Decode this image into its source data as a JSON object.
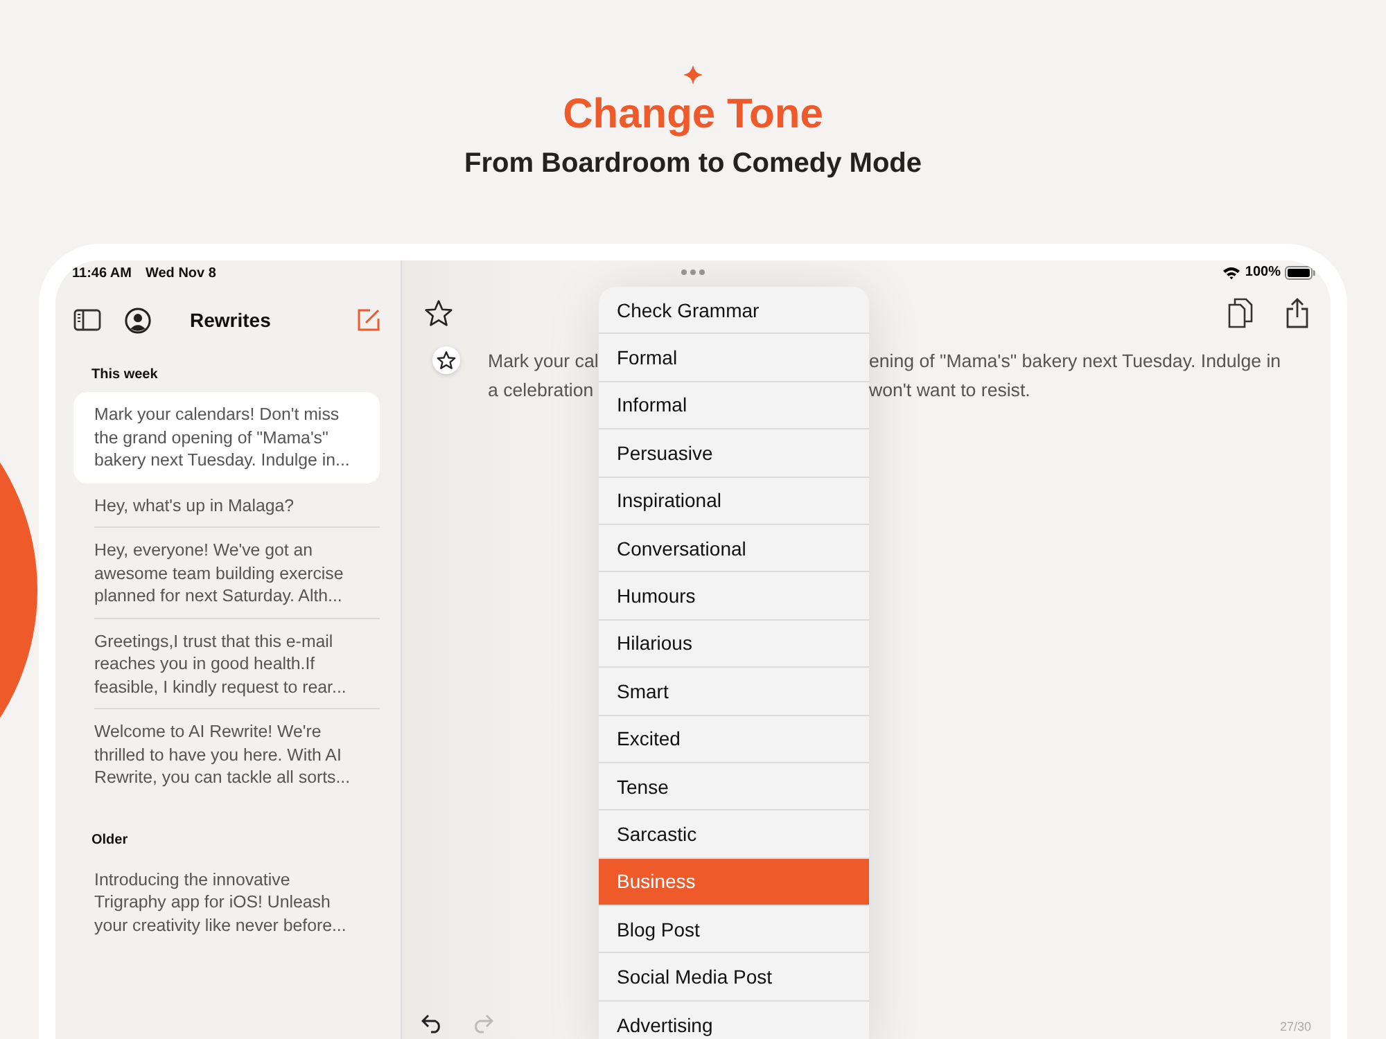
{
  "header": {
    "title": "Change Tone",
    "subtitle": "From Boardroom to Comedy Mode"
  },
  "status_bar": {
    "time": "11:46 AM",
    "date": "Wed Nov 8",
    "battery": "100%"
  },
  "sidebar": {
    "title": "Rewrites",
    "sections": [
      {
        "title": "This week",
        "items": [
          {
            "text": "Mark your calendars! Don't miss the grand opening of \"Mama's\" bakery next Tuesday. Indulge in...",
            "selected": true
          },
          {
            "text": "Hey, what's up in Malaga?",
            "selected": false
          },
          {
            "text": "Hey, everyone! We've got an awesome team building exercise planned for next Saturday. Alth...",
            "selected": false
          },
          {
            "text": "Greetings,I trust that this e-mail reaches you in good health.If feasible, I kindly request to rear...",
            "selected": false
          },
          {
            "text": "Welcome to AI Rewrite! We're thrilled to have you here. With AI Rewrite, you can tackle all sorts...",
            "selected": false
          }
        ]
      },
      {
        "title": "Older",
        "items": [
          {
            "text": "Introducing the innovative Trigraphy app for iOS! Unleash your creativity like never before...",
            "selected": false
          }
        ]
      }
    ]
  },
  "editor": {
    "lines": [
      {
        "left": "Mark your cal",
        "right": "ening of \"Mama's\" bakery next Tuesday. Indulge in"
      },
      {
        "left": "a celebration",
        "right": "won't want to resist."
      }
    ],
    "undo": {
      "disabled": false
    },
    "redo": {
      "disabled": true
    },
    "counter": "27/30"
  },
  "menu": {
    "items": [
      {
        "label": "Check Grammar",
        "selected": false
      },
      {
        "label": "Formal",
        "selected": false
      },
      {
        "label": "Informal",
        "selected": false
      },
      {
        "label": "Persuasive",
        "selected": false
      },
      {
        "label": "Inspirational",
        "selected": false
      },
      {
        "label": "Conversational",
        "selected": false
      },
      {
        "label": "Humours",
        "selected": false
      },
      {
        "label": "Hilarious",
        "selected": false
      },
      {
        "label": "Smart",
        "selected": false
      },
      {
        "label": "Excited",
        "selected": false
      },
      {
        "label": "Tense",
        "selected": false
      },
      {
        "label": "Sarcastic",
        "selected": false
      },
      {
        "label": "Business",
        "selected": true
      },
      {
        "label": "Blog Post",
        "selected": false
      },
      {
        "label": "Social Media Post",
        "selected": false
      },
      {
        "label": "Advertising",
        "selected": false
      }
    ]
  }
}
